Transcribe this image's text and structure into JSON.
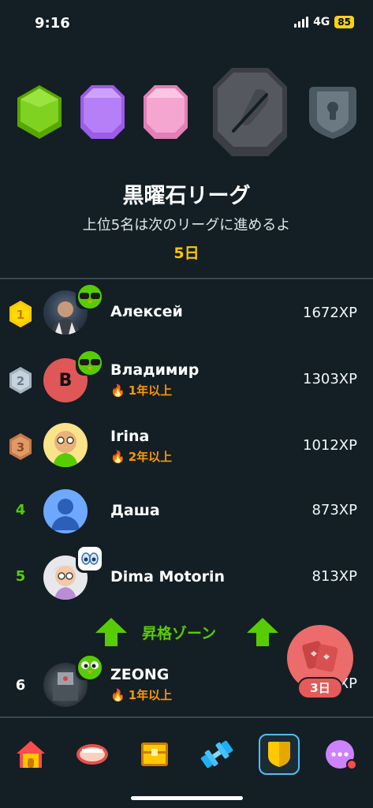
{
  "status": {
    "time": "9:16",
    "network": "4G",
    "battery": "85"
  },
  "league": {
    "title": "黒曜石リーグ",
    "subtitle": "上位5名は次のリーグに進めるよ",
    "days_left": "5日"
  },
  "leaderboard": [
    {
      "rank": "1",
      "name": "Алексей",
      "xp": "1672XP",
      "streak": ""
    },
    {
      "rank": "2",
      "name": "Владимир",
      "xp": "1303XP",
      "streak": "1年以上",
      "initial": "B"
    },
    {
      "rank": "3",
      "name": "Irina",
      "xp": "1012XP",
      "streak": "2年以上"
    },
    {
      "rank": "4",
      "name": "Даша",
      "xp": "873XP",
      "streak": ""
    },
    {
      "rank": "5",
      "name": "Dima Motorin",
      "xp": "813XP",
      "streak": ""
    },
    {
      "rank": "6",
      "name": "ZEONG",
      "xp": "XP",
      "streak": "1年以上"
    }
  ],
  "promotion_zone": {
    "label": "昇格ゾーン"
  },
  "chest": {
    "days": "3日"
  },
  "colors": {
    "background": "#131f24",
    "accent_green": "#58cc02",
    "gold": "#ffc800",
    "streak_orange": "#ff9600"
  },
  "nav": {
    "items": [
      {
        "icon": "home-icon"
      },
      {
        "icon": "mouth-icon"
      },
      {
        "icon": "chest-icon"
      },
      {
        "icon": "dumbbell-icon"
      },
      {
        "icon": "shield-icon",
        "active": true
      },
      {
        "icon": "more-icon"
      }
    ]
  }
}
